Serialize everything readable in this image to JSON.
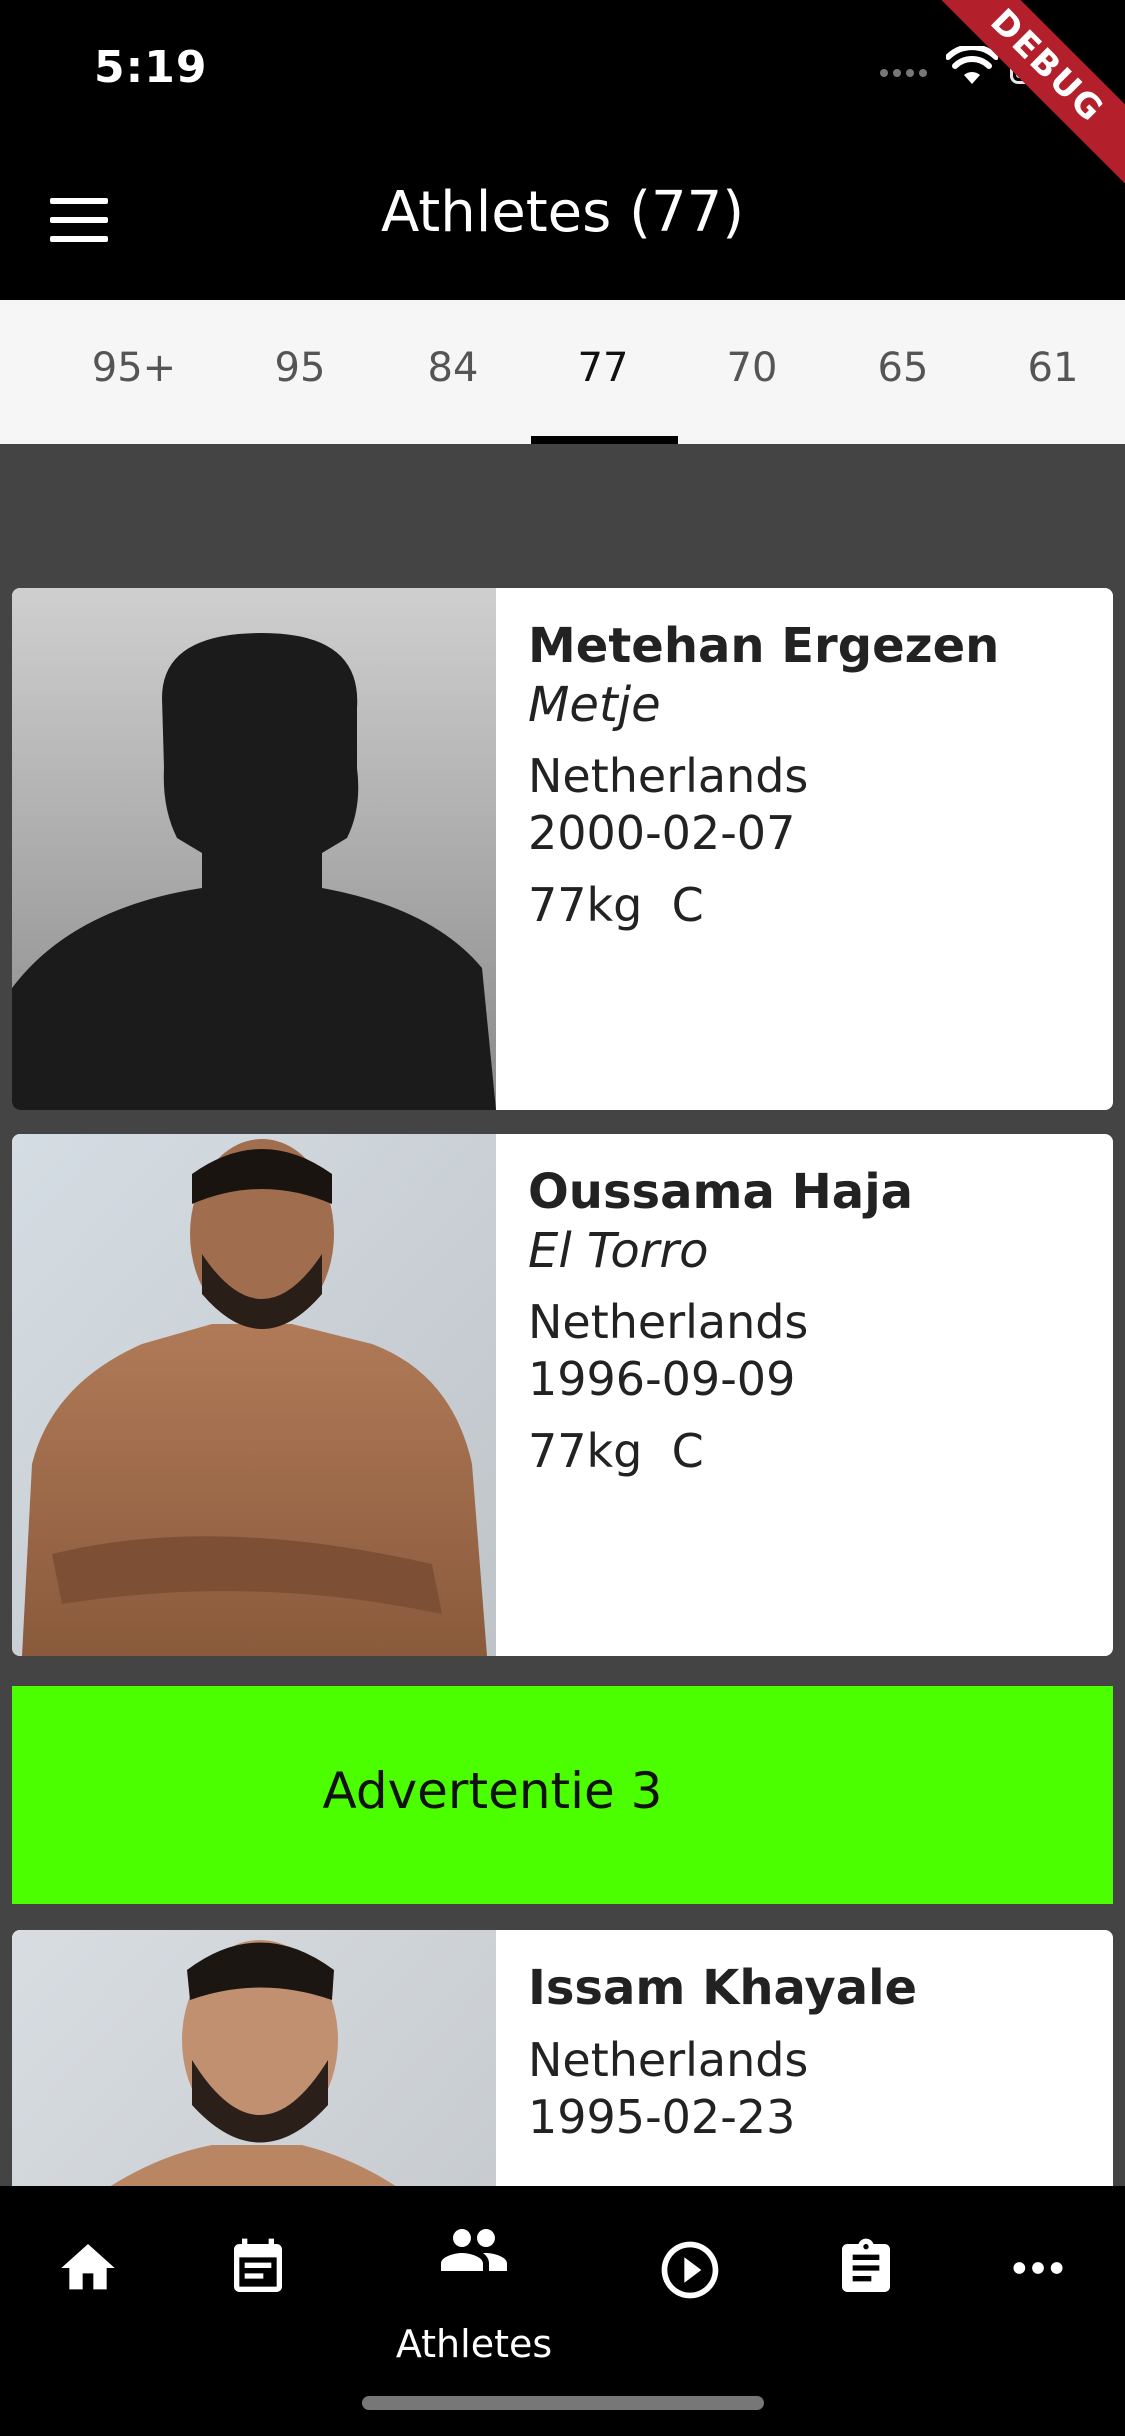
{
  "status_bar": {
    "time": "5:19",
    "debug_label": "DEBUG"
  },
  "app_bar": {
    "title": "Athletes (77)"
  },
  "tabs": [
    {
      "label": "95+"
    },
    {
      "label": "95"
    },
    {
      "label": "84"
    },
    {
      "label": "77",
      "selected": true
    },
    {
      "label": "70"
    },
    {
      "label": "65"
    },
    {
      "label": "61"
    }
  ],
  "athletes": [
    {
      "name": "Metehan Ergezen",
      "nickname": "Metje",
      "country": "Netherlands",
      "dob": "2000-02-07",
      "weight": "77kg",
      "class": "C",
      "photo": "placeholder-silhouette"
    },
    {
      "name": "Oussama Haja",
      "nickname": "El Torro",
      "country": "Netherlands",
      "dob": "1996-09-09",
      "weight": "77kg",
      "class": "C",
      "photo": "athlete-photo"
    },
    {
      "name": "Issam Khayale",
      "nickname": "",
      "country": "Netherlands",
      "dob": "1995-02-23",
      "photo": "athlete-photo"
    }
  ],
  "ad": {
    "text": "Advertentie 3",
    "color": "#4cff00"
  },
  "bottom_nav": {
    "items": [
      {
        "icon": "home-icon"
      },
      {
        "icon": "calendar-event-icon"
      },
      {
        "icon": "people-icon",
        "label": "Athletes",
        "selected": true
      },
      {
        "icon": "play-circle-icon"
      },
      {
        "icon": "clipboard-icon"
      },
      {
        "icon": "more-horiz-icon"
      }
    ]
  }
}
